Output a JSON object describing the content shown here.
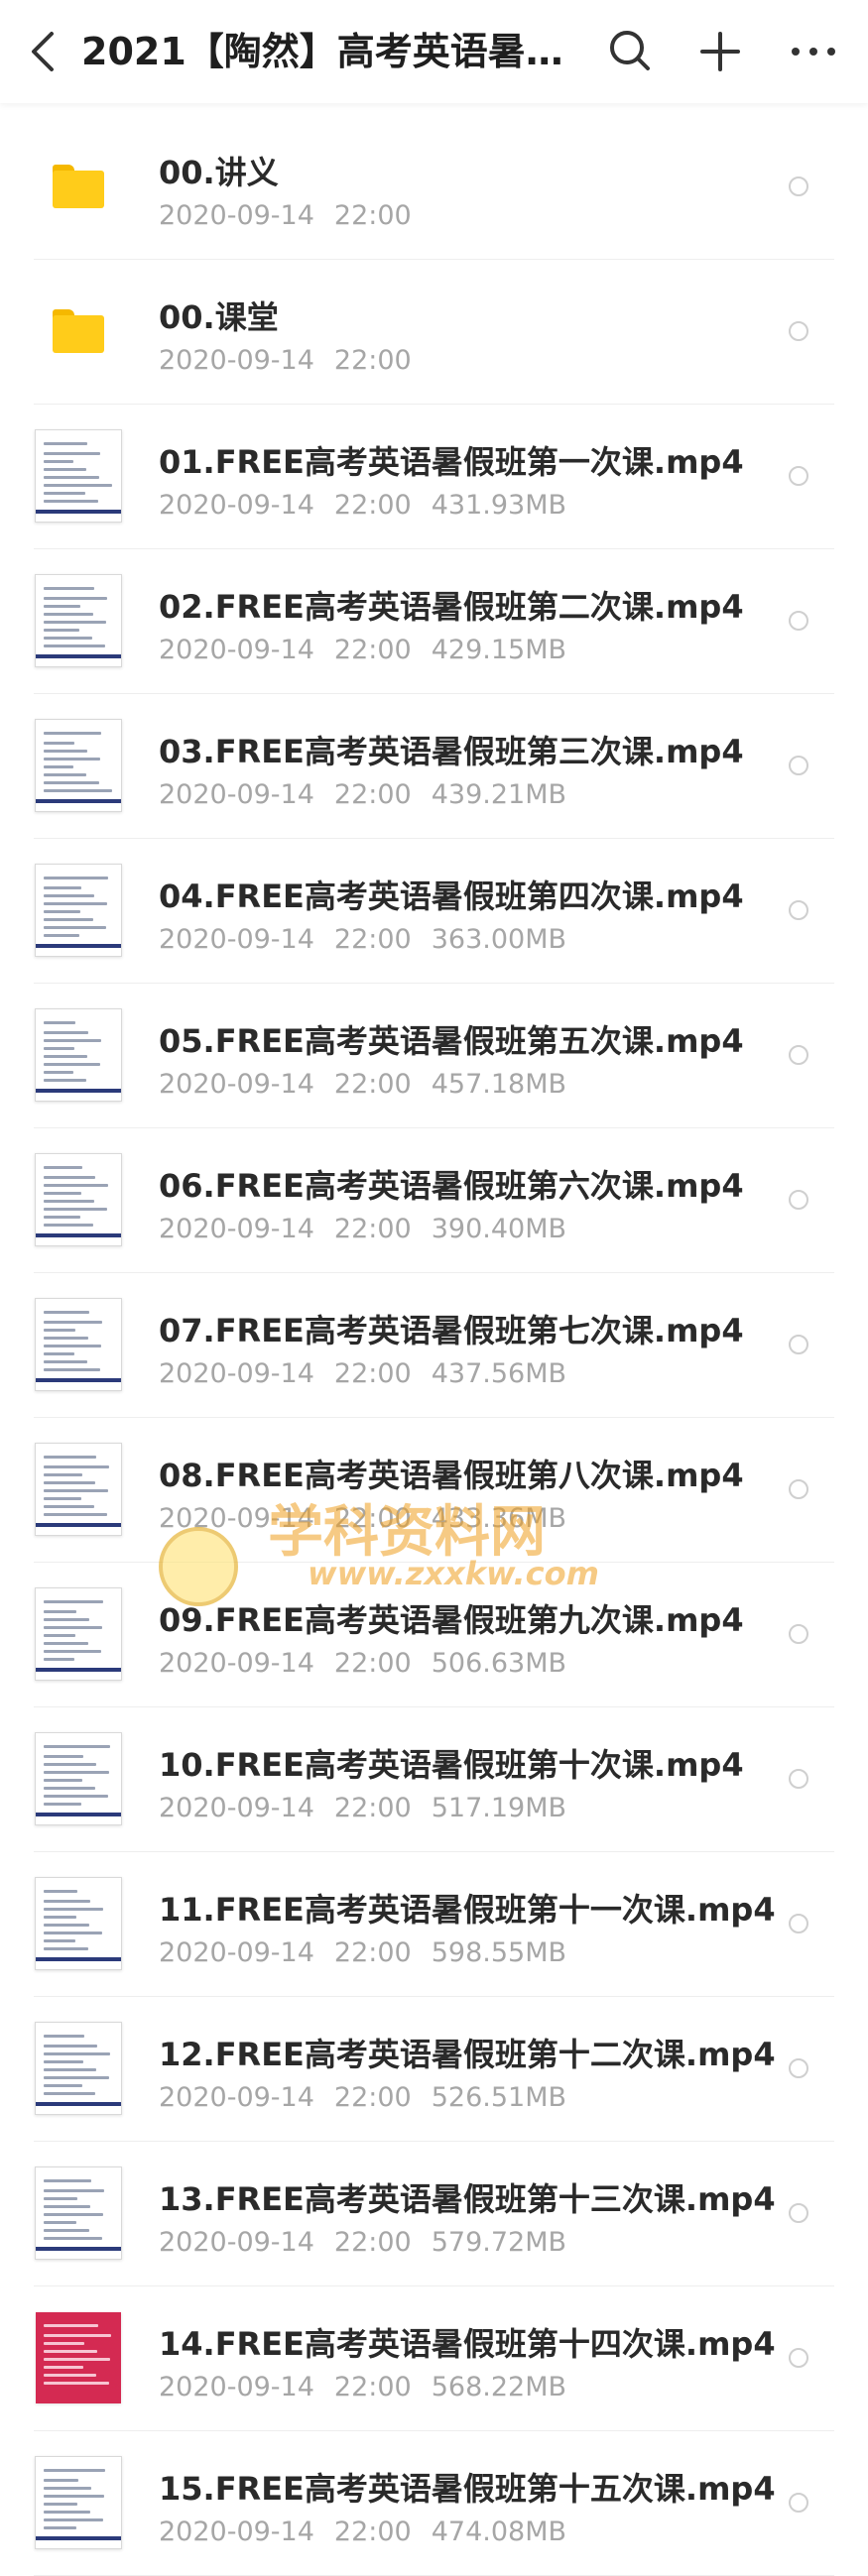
{
  "header": {
    "title": "2021【陶然】高考英语暑假...",
    "icons": {
      "back": "back-arrow-icon",
      "search": "search-icon",
      "add": "plus-icon",
      "more": "more-dots-icon"
    }
  },
  "colors": {
    "folder": "#ffcc1a",
    "title_text": "#2a2a2a",
    "meta_text": "#a6a6a6"
  },
  "files": [
    {
      "name": "00.讲义",
      "date": "2020-09-14",
      "time": "22:00",
      "size": "",
      "kind": "folder"
    },
    {
      "name": "00.课堂",
      "date": "2020-09-14",
      "time": "22:00",
      "size": "",
      "kind": "folder"
    },
    {
      "name": "01.FREE高考英语暑假班第一次课.mp4",
      "date": "2020-09-14",
      "time": "22:00",
      "size": "431.93MB",
      "kind": "video"
    },
    {
      "name": "02.FREE高考英语暑假班第二次课.mp4",
      "date": "2020-09-14",
      "time": "22:00",
      "size": "429.15MB",
      "kind": "video"
    },
    {
      "name": "03.FREE高考英语暑假班第三次课.mp4",
      "date": "2020-09-14",
      "time": "22:00",
      "size": "439.21MB",
      "kind": "video"
    },
    {
      "name": "04.FREE高考英语暑假班第四次课.mp4",
      "date": "2020-09-14",
      "time": "22:00",
      "size": "363.00MB",
      "kind": "video"
    },
    {
      "name": "05.FREE高考英语暑假班第五次课.mp4",
      "date": "2020-09-14",
      "time": "22:00",
      "size": "457.18MB",
      "kind": "video"
    },
    {
      "name": "06.FREE高考英语暑假班第六次课.mp4",
      "date": "2020-09-14",
      "time": "22:00",
      "size": "390.40MB",
      "kind": "video"
    },
    {
      "name": "07.FREE高考英语暑假班第七次课.mp4",
      "date": "2020-09-14",
      "time": "22:00",
      "size": "437.56MB",
      "kind": "video"
    },
    {
      "name": "08.FREE高考英语暑假班第八次课.mp4",
      "date": "2020-09-14",
      "time": "22:00",
      "size": "433.36MB",
      "kind": "video"
    },
    {
      "name": "09.FREE高考英语暑假班第九次课.mp4",
      "date": "2020-09-14",
      "time": "22:00",
      "size": "506.63MB",
      "kind": "video"
    },
    {
      "name": "10.FREE高考英语暑假班第十次课.mp4",
      "date": "2020-09-14",
      "time": "22:00",
      "size": "517.19MB",
      "kind": "video"
    },
    {
      "name": "11.FREE高考英语暑假班第十一次课.mp4",
      "date": "2020-09-14",
      "time": "22:00",
      "size": "598.55MB",
      "kind": "video"
    },
    {
      "name": "12.FREE高考英语暑假班第十二次课.mp4",
      "date": "2020-09-14",
      "time": "22:00",
      "size": "526.51MB",
      "kind": "video"
    },
    {
      "name": "13.FREE高考英语暑假班第十三次课.mp4",
      "date": "2020-09-14",
      "time": "22:00",
      "size": "579.72MB",
      "kind": "video"
    },
    {
      "name": "14.FREE高考英语暑假班第十四次课.mp4",
      "date": "2020-09-14",
      "time": "22:00",
      "size": "568.22MB",
      "kind": "video-red"
    },
    {
      "name": "15.FREE高考英语暑假班第十五次课.mp4",
      "date": "2020-09-14",
      "time": "22:00",
      "size": "474.08MB",
      "kind": "video"
    }
  ],
  "watermark": {
    "text": "学科资料网",
    "url": "www.zxxkw.com"
  }
}
